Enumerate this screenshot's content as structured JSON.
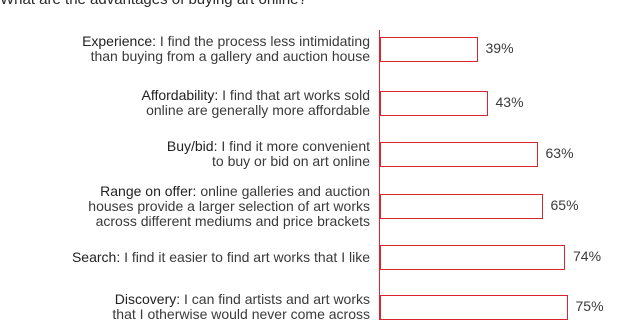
{
  "title": "What are the advantages of buying art online?",
  "chart_data": {
    "type": "bar",
    "orientation": "horizontal",
    "title": "What are the advantages of buying art online?",
    "categories": [
      {
        "name": "Experience:",
        "lines": [
          "I find the process less intimidating",
          "than buying from a gallery and auction house"
        ]
      },
      {
        "name": "Affordability:",
        "lines": [
          "I find that art works sold",
          "online are generally more affordable"
        ]
      },
      {
        "name": "Buy/bid:",
        "lines": [
          "I find it more convenient",
          "to buy or bid on art online"
        ]
      },
      {
        "name": "Range on offer:",
        "lines": [
          "online galleries and auction",
          "houses provide a larger selection of art works",
          "across different mediums and price brackets"
        ]
      },
      {
        "name": "Search:",
        "lines": [
          "I find it easier to find art works that I like"
        ]
      },
      {
        "name": "Discovery:",
        "lines": [
          "I can find artists and art works",
          "that I otherwise would never come across"
        ]
      }
    ],
    "values": [
      39,
      43,
      63,
      65,
      74,
      75
    ],
    "value_suffix": "%",
    "xlim": [
      0,
      100
    ],
    "bar_fill": "#ffffff",
    "bar_stroke": "#d9262c"
  }
}
